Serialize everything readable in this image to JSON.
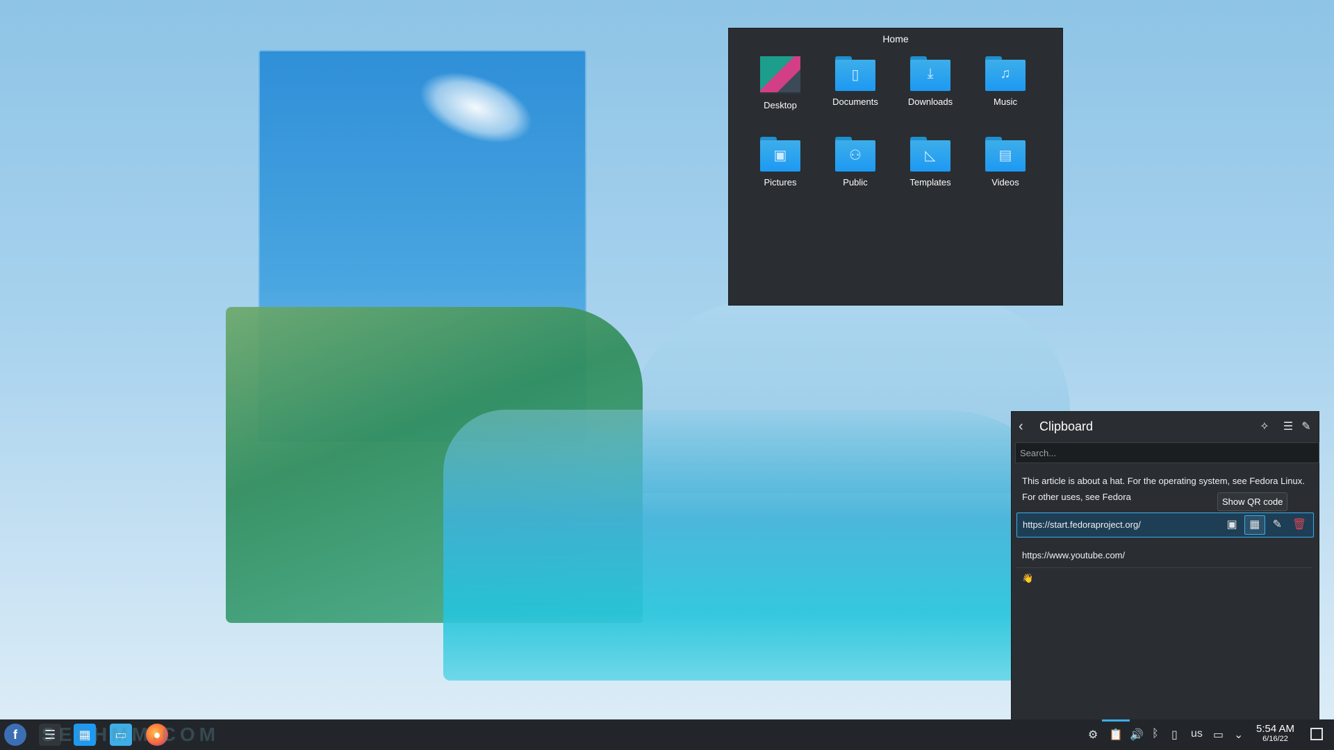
{
  "home_popup": {
    "title": "Home",
    "items": [
      {
        "label": "Desktop",
        "icon": "desktop-folder-icon"
      },
      {
        "label": "Documents",
        "icon": "documents-folder-icon"
      },
      {
        "label": "Downloads",
        "icon": "downloads-folder-icon"
      },
      {
        "label": "Music",
        "icon": "music-folder-icon"
      },
      {
        "label": "Pictures",
        "icon": "pictures-folder-icon"
      },
      {
        "label": "Public",
        "icon": "public-folder-icon"
      },
      {
        "label": "Templates",
        "icon": "templates-folder-icon"
      },
      {
        "label": "Videos",
        "icon": "videos-folder-icon"
      }
    ]
  },
  "clipboard": {
    "title": "Clipboard",
    "search_placeholder": "Search...",
    "entries": [
      {
        "text": "This article is about a hat. For the operating system, see Fedora Linux. For other uses, see Fedora"
      },
      {
        "text": "https://start.fedoraproject.org/"
      },
      {
        "text": "https://www.youtube.com/"
      },
      {
        "text": "👋"
      }
    ],
    "tooltip": "Show QR code"
  },
  "taskbar": {
    "watermark": "SEEHMM.COM",
    "keyboard_layout": "us",
    "time": "5:54 AM",
    "date": "6/16/22"
  },
  "colors": {
    "accent": "#3daee9",
    "panel_bg": "#2a2e32",
    "taskbar_bg": "#22262a",
    "delete": "#da4453"
  }
}
